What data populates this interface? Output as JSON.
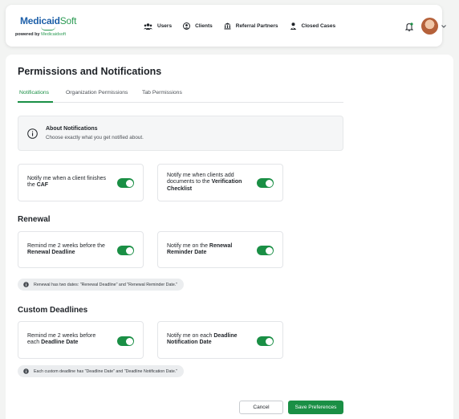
{
  "header": {
    "logo_main": "Medicaid",
    "logo_accent": "Soft",
    "powered_prefix": "powered by ",
    "powered_brand": "Medicaidsoft",
    "nav": [
      {
        "label": "Users",
        "icon": "users-icon"
      },
      {
        "label": "Clients",
        "icon": "clients-icon"
      },
      {
        "label": "Referral Partners",
        "icon": "bank-icon"
      },
      {
        "label": "Closed Cases",
        "icon": "user-check-icon"
      }
    ],
    "bell_icon": "bell-icon",
    "avatar_icon": "avatar"
  },
  "page": {
    "title": "Permissions and Notifications",
    "tabs": [
      {
        "label": "Notifications",
        "active": true
      },
      {
        "label": "Organization Permissions",
        "active": false
      },
      {
        "label": "Tab Permissions",
        "active": false
      }
    ]
  },
  "about": {
    "title": "About Notifications",
    "subtitle": "Choose exactly what you get notified about."
  },
  "general_options": [
    {
      "pre": "Notify me when a client finishes the ",
      "bold": "CAF",
      "enabled": true
    },
    {
      "pre": "Notify me when clients add documents to the ",
      "bold": "Verification Checklist",
      "enabled": true
    }
  ],
  "renewal": {
    "title": "Renewal",
    "options": [
      {
        "pre": "Remind me 2 weeks before the ",
        "bold": "Renewal Deadline",
        "enabled": true
      },
      {
        "pre": "Notify me on the ",
        "bold": "Renewal Reminder Date",
        "enabled": true
      }
    ],
    "note": "Renewal has two dates: \"Renewal Deadline\" and \"Renewal Reminder Date.\""
  },
  "custom": {
    "title": "Custom Deadlines",
    "options": [
      {
        "pre": "Remind me 2 weeks before each ",
        "bold": "Deadline Date",
        "enabled": true
      },
      {
        "pre": "Notify me on each ",
        "bold": "Deadline Notification Date",
        "enabled": true
      }
    ],
    "note": "Each custom deadline has \"Deadline Date\" and \"Deadline Notification Date.\""
  },
  "actions": {
    "cancel": "Cancel",
    "save": "Save Preferences"
  },
  "colors": {
    "accent_green": "#1a8f45",
    "logo_blue": "#1d5fa8",
    "background": "#f3f4f3"
  }
}
